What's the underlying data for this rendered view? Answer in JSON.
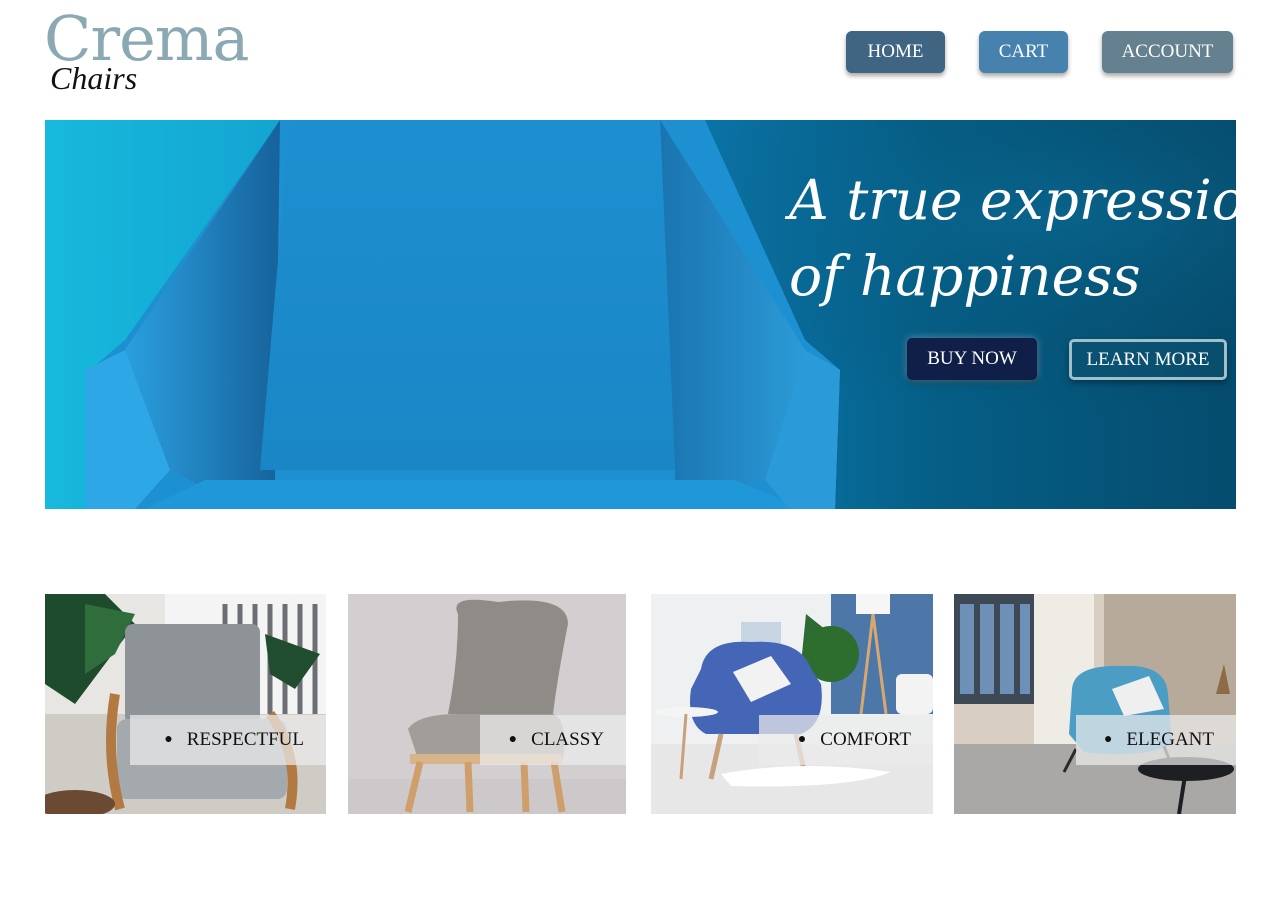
{
  "logo": {
    "brand": "Crema",
    "sub": "Chairs"
  },
  "nav": {
    "home": "HOME",
    "cart": "CART",
    "account": "ACCOUNT"
  },
  "hero": {
    "line1": "A true expression",
    "line2": "of happiness",
    "buy_label": "BUY NOW",
    "learn_label": "LEARN MORE"
  },
  "features": [
    {
      "label": "RESPECTFUL"
    },
    {
      "label": "CLASSY"
    },
    {
      "label": "COMFORT"
    },
    {
      "label": "ELEGANT"
    }
  ],
  "colors": {
    "logo": "#8aa9b3",
    "nav_home": "#3f6582",
    "nav_cart": "#4781ad",
    "nav_account": "#65808f",
    "buy_button": "#0f1f48",
    "hero_chair": "#1e8fd3"
  }
}
